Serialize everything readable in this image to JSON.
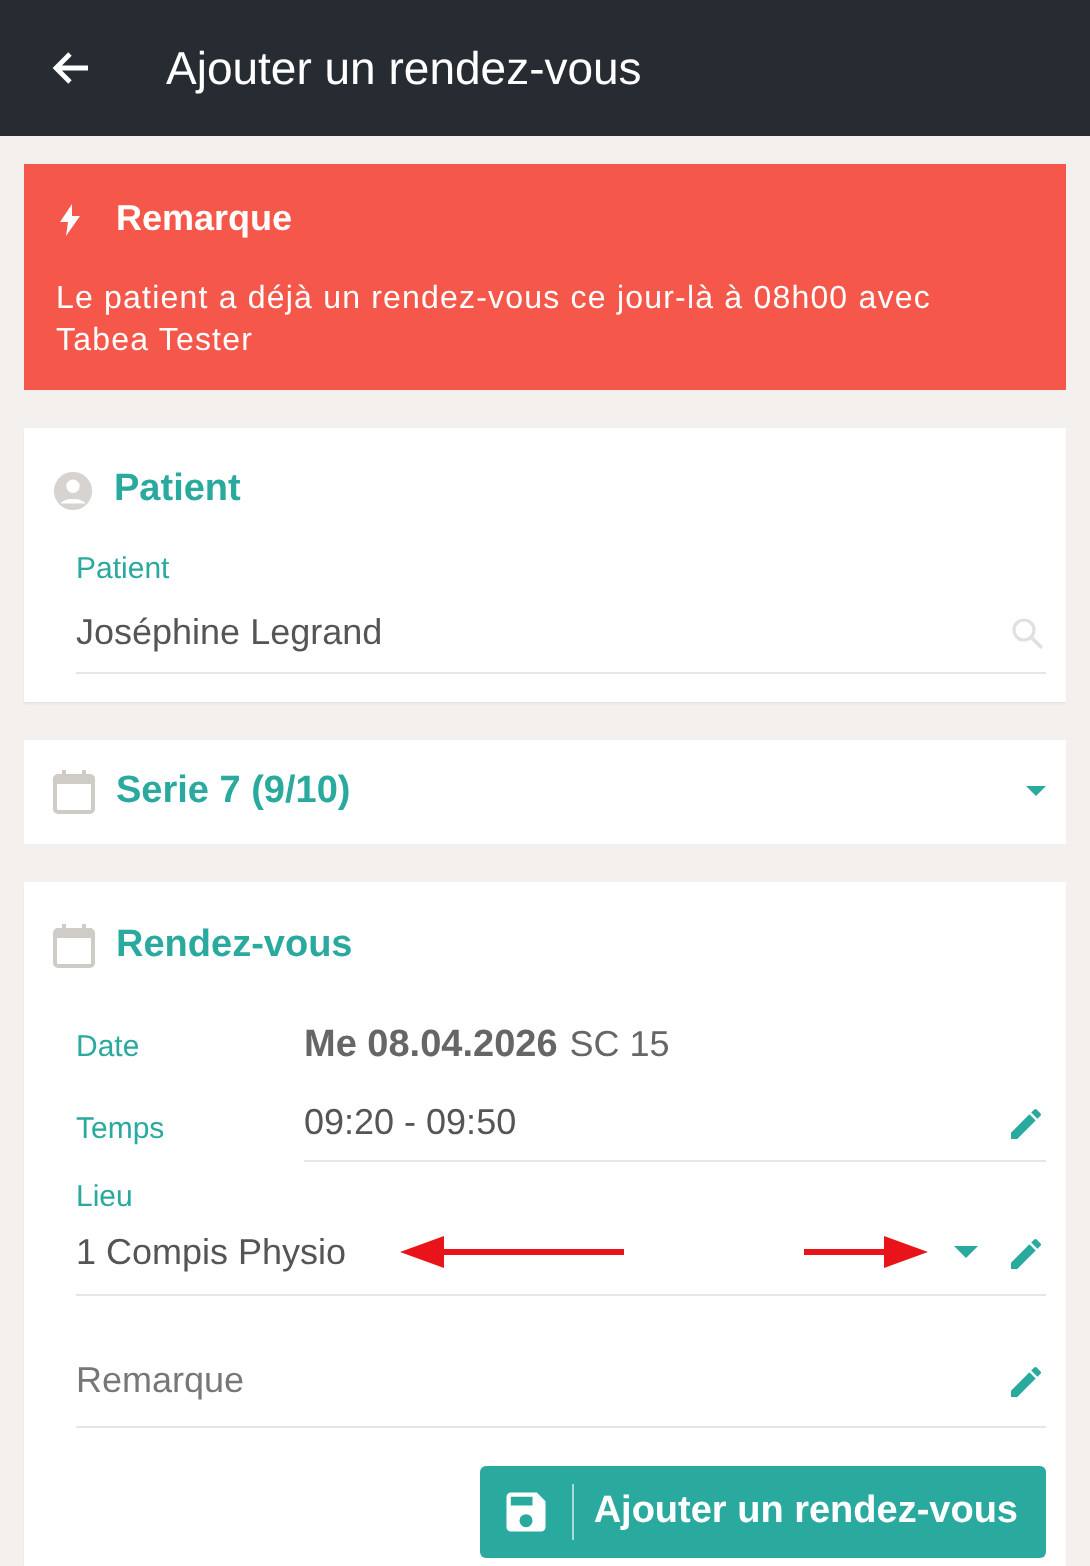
{
  "app_bar": {
    "title": "Ajouter un rendez-vous"
  },
  "alert": {
    "title": "Remarque",
    "message": "Le patient a déjà un rendez-vous ce jour-là à 08h00 avec Tabea Tester"
  },
  "patient_section": {
    "title": "Patient",
    "field": {
      "label": "Patient",
      "value": "Joséphine Legrand"
    }
  },
  "series": {
    "title": "Serie 7 (9/10)",
    "expanded": false
  },
  "appointment": {
    "title": "Rendez-vous",
    "date": {
      "label": "Date",
      "value": "Me 08.04.2026",
      "room": "SC 15"
    },
    "time": {
      "label": "Temps",
      "value": "09:20 - 09:50"
    },
    "location": {
      "label": "Lieu",
      "value": "1 Compis Physio"
    },
    "remark": {
      "placeholder": "Remarque"
    },
    "submit_button": "Ajouter un rendez-vous"
  }
}
